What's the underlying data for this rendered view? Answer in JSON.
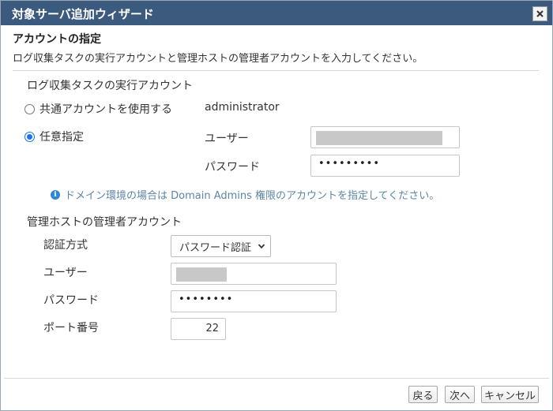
{
  "window": {
    "title": "対象サーバ追加ウィザード"
  },
  "section": {
    "heading": "アカウントの指定",
    "description": "ログ収集タスクの実行アカウントと管理ホストの管理者アカウントを入力してください。"
  },
  "log_task_account": {
    "title": "ログ収集タスクの実行アカウント",
    "option_common": {
      "label": "共通アカウントを使用する",
      "value": "administrator",
      "selected": false
    },
    "option_custom": {
      "label": "任意指定",
      "selected": true
    },
    "user_label": "ユーザー",
    "password_label": "パスワード",
    "password_value": "•••••••••",
    "info": "ドメイン環境の場合は Domain Admins 権限のアカウントを指定してください。"
  },
  "admin_account": {
    "title": "管理ホストの管理者アカウント",
    "auth_label": "認証方式",
    "auth_value": "パスワード認証",
    "user_label": "ユーザー",
    "password_label": "パスワード",
    "password_value": "••••••••",
    "port_label": "ポート番号",
    "port_value": "22"
  },
  "footer": {
    "back": "戻る",
    "next": "次へ",
    "cancel": "キャンセル"
  },
  "colors": {
    "titlebar": "#3b5a7e",
    "accent": "#1a73e8",
    "info_text": "#5a86a6"
  },
  "icons": {
    "close": "close-icon",
    "info": "info-icon",
    "chevron": "chevron-down-icon"
  }
}
